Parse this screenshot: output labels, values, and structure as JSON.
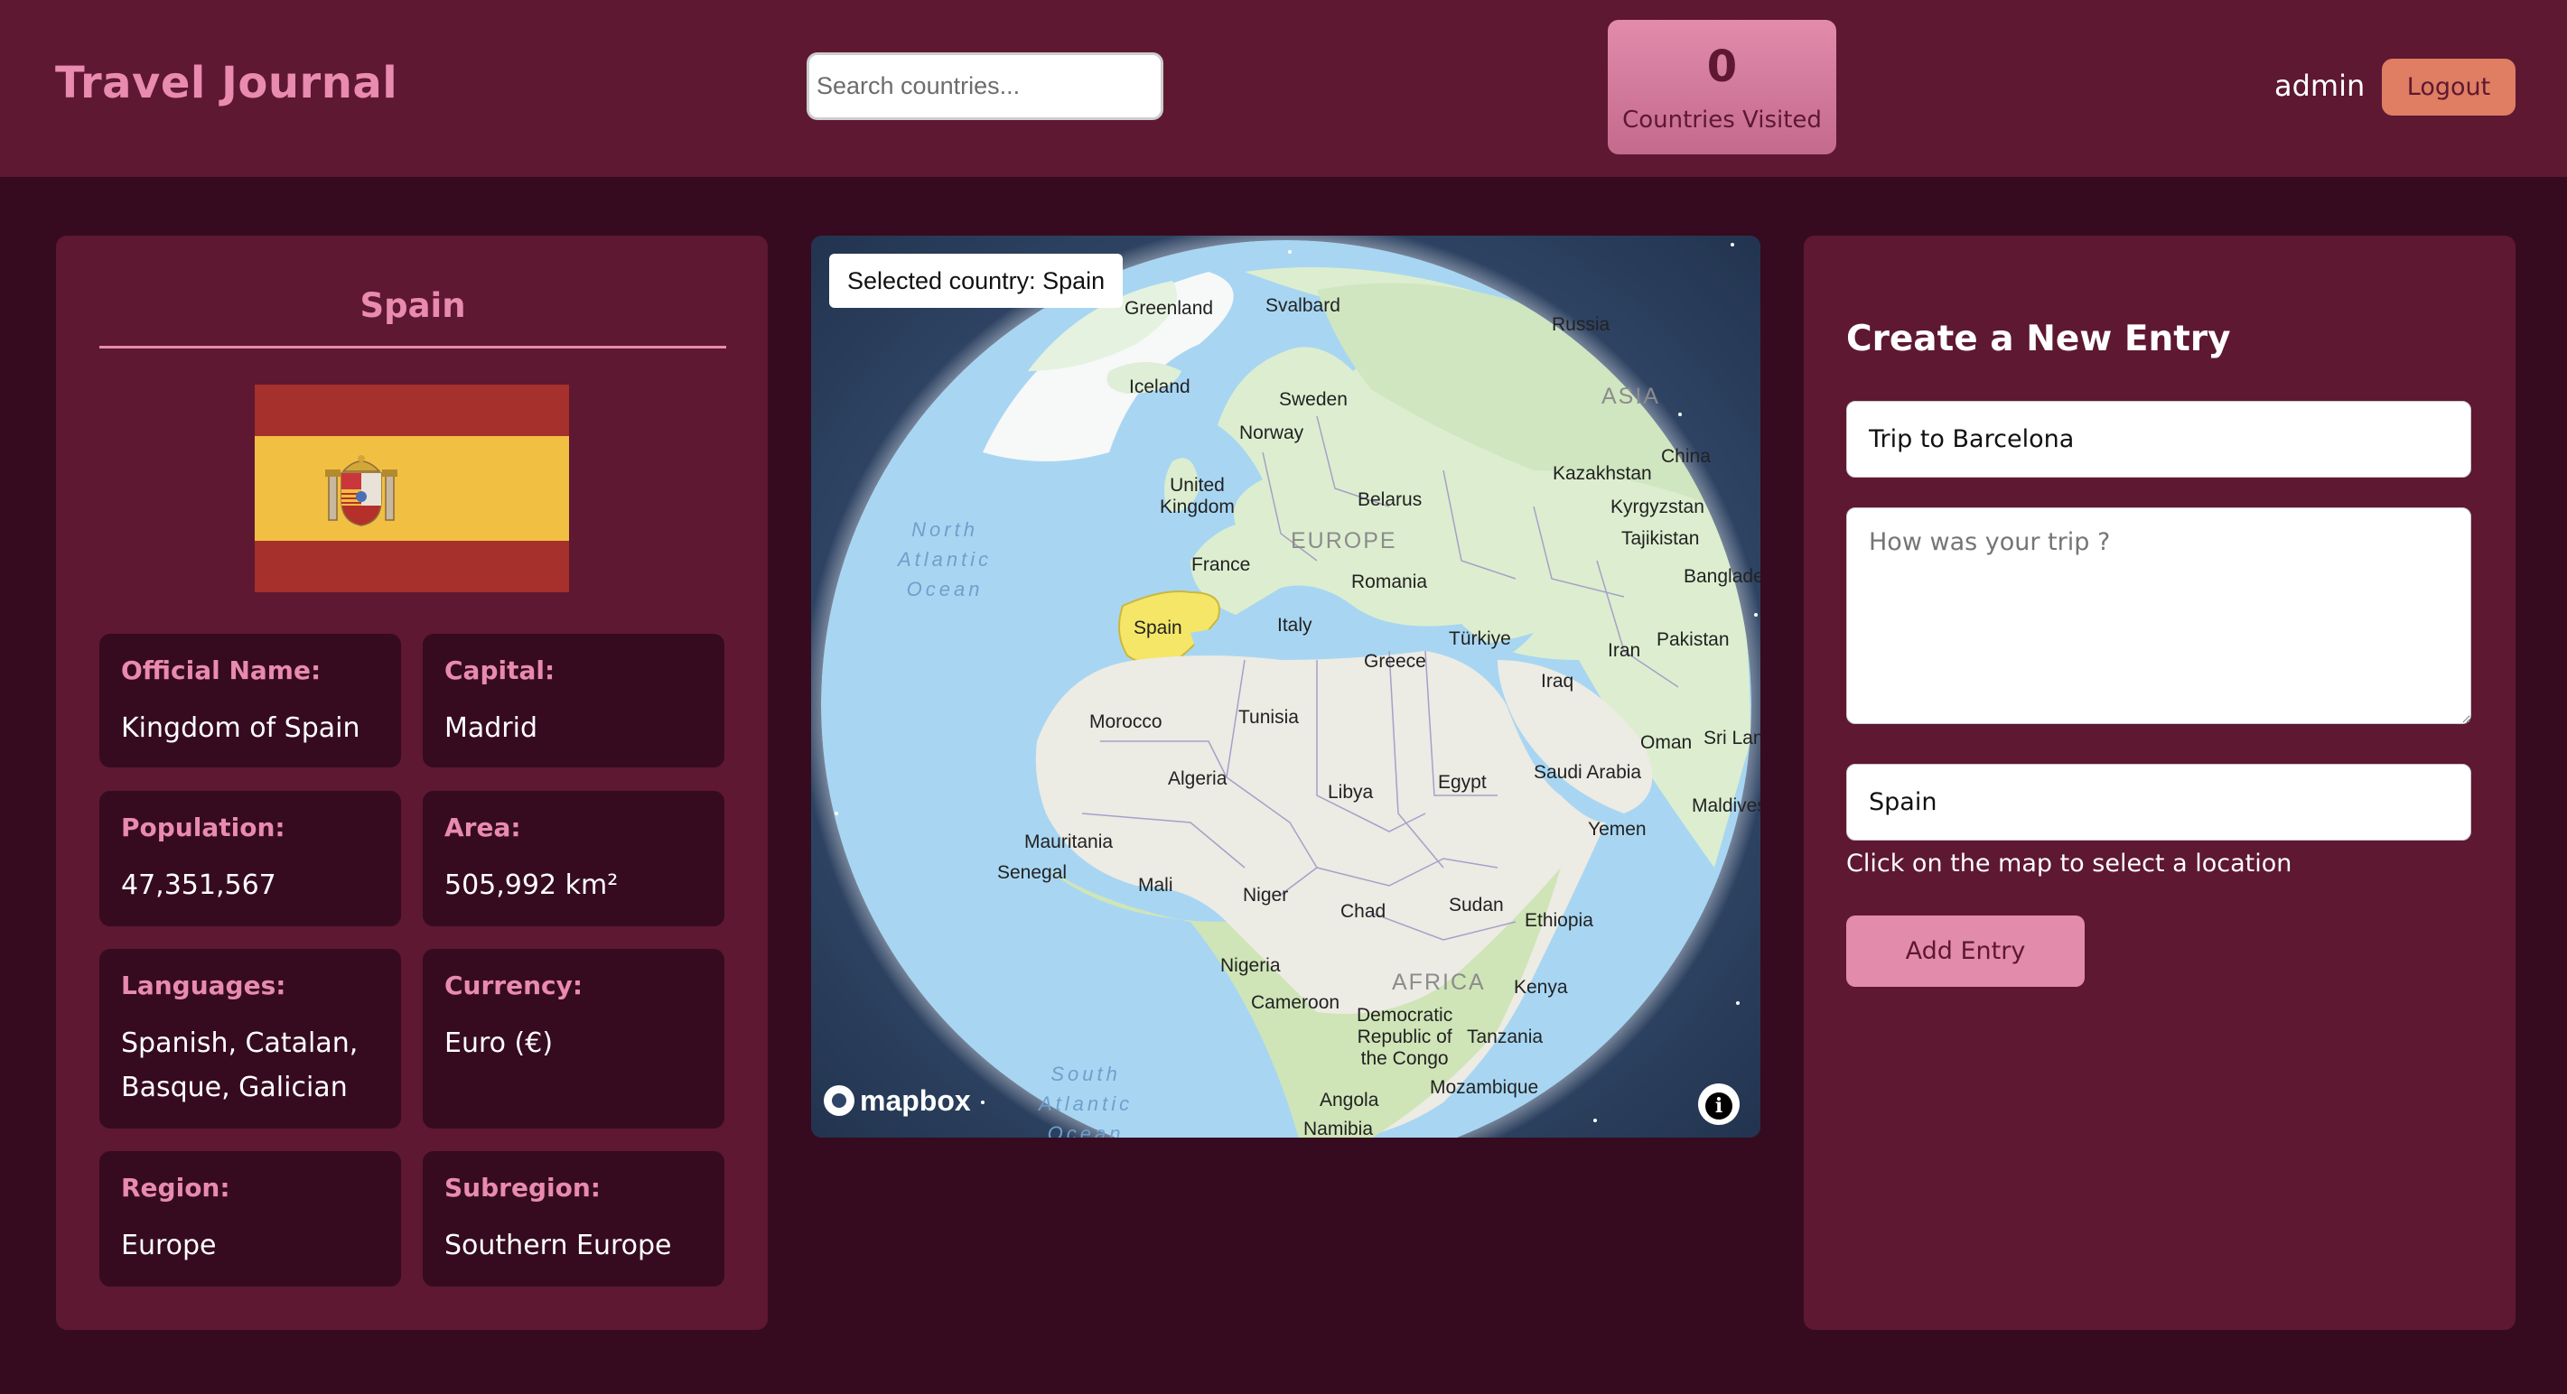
{
  "header": {
    "brand": "Travel Journal",
    "search_placeholder": "Search countries...",
    "stat_value": "0",
    "stat_label": "Countries Visited",
    "user": "admin",
    "logout_label": "Logout"
  },
  "country": {
    "name": "Spain",
    "flag_colors": {
      "red": "#a6302b",
      "yellow": "#f1bf42"
    },
    "facts": [
      {
        "label": "Official Name:",
        "value": "Kingdom of Spain"
      },
      {
        "label": "Capital:",
        "value": "Madrid"
      },
      {
        "label": "Population:",
        "value": "47,351,567"
      },
      {
        "label": "Area:",
        "value": "505,992 km²"
      },
      {
        "label": "Languages:",
        "value": "Spanish, Catalan, Basque, Galician"
      },
      {
        "label": "Currency:",
        "value": "Euro (€)"
      },
      {
        "label": "Region:",
        "value": "Europe"
      },
      {
        "label": "Subregion:",
        "value": "Southern Europe"
      }
    ]
  },
  "map": {
    "selected_label": "Selected country: Spain",
    "attribution": "mapbox",
    "info_icon": "info-icon",
    "labels": {
      "greenland": "Greenland",
      "svalbard": "Svalbard",
      "russia": "Russia",
      "asia": "ASIA",
      "iceland": "Iceland",
      "sweden": "Sweden",
      "norway": "Norway",
      "china": "China",
      "kazakhstan": "Kazakhstan",
      "kyrgyzstan": "Kyrgyzstan",
      "tajikistan": "Tajikistan",
      "uk": "United\nKingdom",
      "belarus": "Belarus",
      "europe": "EUROPE",
      "north_atlantic": "North\nAtlantic\nOcean",
      "bangladesh": "Banglade",
      "france": "France",
      "romania": "Romania",
      "spain": "Spain",
      "italy": "Italy",
      "turkiye": "Türkiye",
      "pakistan": "Pakistan",
      "iran": "Iran",
      "greece": "Greece",
      "iraq": "Iraq",
      "morocco": "Morocco",
      "tunisia": "Tunisia",
      "oman": "Oman",
      "srilanka": "Sri Lan",
      "algeria": "Algeria",
      "libya": "Libya",
      "egypt": "Egypt",
      "saudi": "Saudi Arabia",
      "maldives": "Maldives",
      "yemen": "Yemen",
      "mauritania": "Mauritania",
      "senegal": "Senegal",
      "mali": "Mali",
      "niger": "Niger",
      "chad": "Chad",
      "sudan": "Sudan",
      "ethiopia": "Ethiopia",
      "nigeria": "Nigeria",
      "cameroon": "Cameroon",
      "africa": "AFRICA",
      "kenya": "Kenya",
      "drc": "Democratic\nRepublic of\nthe Congo",
      "tanzania": "Tanzania",
      "south_atlantic": "South\nAtlantic\nOcean",
      "mozambique": "Mozambique",
      "angola": "Angola",
      "namibia": "Namibia"
    }
  },
  "form": {
    "title": "Create a New Entry",
    "title_value": "Trip to Barcelona",
    "notes_placeholder": "How was your trip ?",
    "location_value": "Spain",
    "hint": "Click on the map to select a location",
    "submit_label": "Add Entry"
  }
}
